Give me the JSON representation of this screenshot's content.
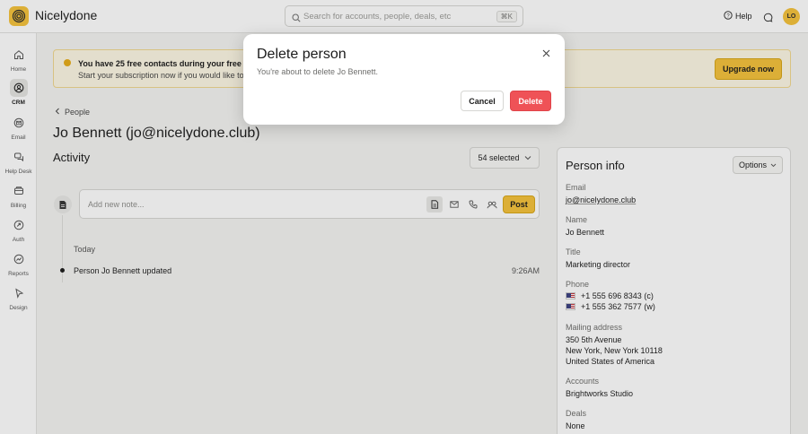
{
  "app": {
    "title": "Nicelydone",
    "logo_icon": "spiral-logo-icon"
  },
  "header": {
    "search_placeholder": "Search for accounts, people, deals, etc",
    "search_shortcut": "⌘K",
    "help_label": "Help",
    "avatar_initials": "LO"
  },
  "sidebar": {
    "items": [
      {
        "label": "Home",
        "icon": "home-icon",
        "active": false
      },
      {
        "label": "CRM",
        "icon": "crm-icon",
        "active": true
      },
      {
        "label": "Email",
        "icon": "email-icon",
        "active": false
      },
      {
        "label": "Help Desk",
        "icon": "help-desk-icon",
        "active": false
      },
      {
        "label": "Billing",
        "icon": "billing-icon",
        "active": false
      },
      {
        "label": "Auth",
        "icon": "auth-icon",
        "active": false
      },
      {
        "label": "Reports",
        "icon": "reports-icon",
        "active": false
      },
      {
        "label": "Design",
        "icon": "design-icon",
        "active": false
      }
    ]
  },
  "banner": {
    "title": "You have 25 free contacts during your free trial",
    "text": "Start your subscription now if you would like to i",
    "button": "Upgrade now"
  },
  "breadcrumb": {
    "label": "People"
  },
  "person": {
    "title": "Jo Bennett (jo@nicelydone.club)"
  },
  "activity": {
    "title": "Activity",
    "selected_label": "54 selected",
    "note_placeholder": "Add new note...",
    "post_label": "Post",
    "group_label": "Today",
    "events": [
      {
        "text": "Person Jo Bennett updated",
        "time": "9:26AM"
      }
    ]
  },
  "info": {
    "title": "Person info",
    "options_label": "Options",
    "email_label": "Email",
    "email_value": "jo@nicelydone.club",
    "name_label": "Name",
    "name_value": "Jo Bennett",
    "title_label": "Title",
    "title_value": "Marketing director",
    "phone_label": "Phone",
    "phones": [
      "+1 555 696 8343 (c)",
      "+1 555 362 7577 (w)"
    ],
    "address_label": "Mailing address",
    "address_lines": [
      "350 5th Avenue",
      "New York, New York  10118",
      "United States of America"
    ],
    "accounts_label": "Accounts",
    "accounts_value": "Brightworks Studio",
    "deals_label": "Deals",
    "deals_value": "None"
  },
  "modal": {
    "title": "Delete person",
    "text": "You're about to delete Jo Bennett.",
    "cancel_label": "Cancel",
    "delete_label": "Delete"
  },
  "colors": {
    "accent": "#f5c23a",
    "danger": "#ef5257",
    "banner_bg": "#fdf7e4"
  }
}
